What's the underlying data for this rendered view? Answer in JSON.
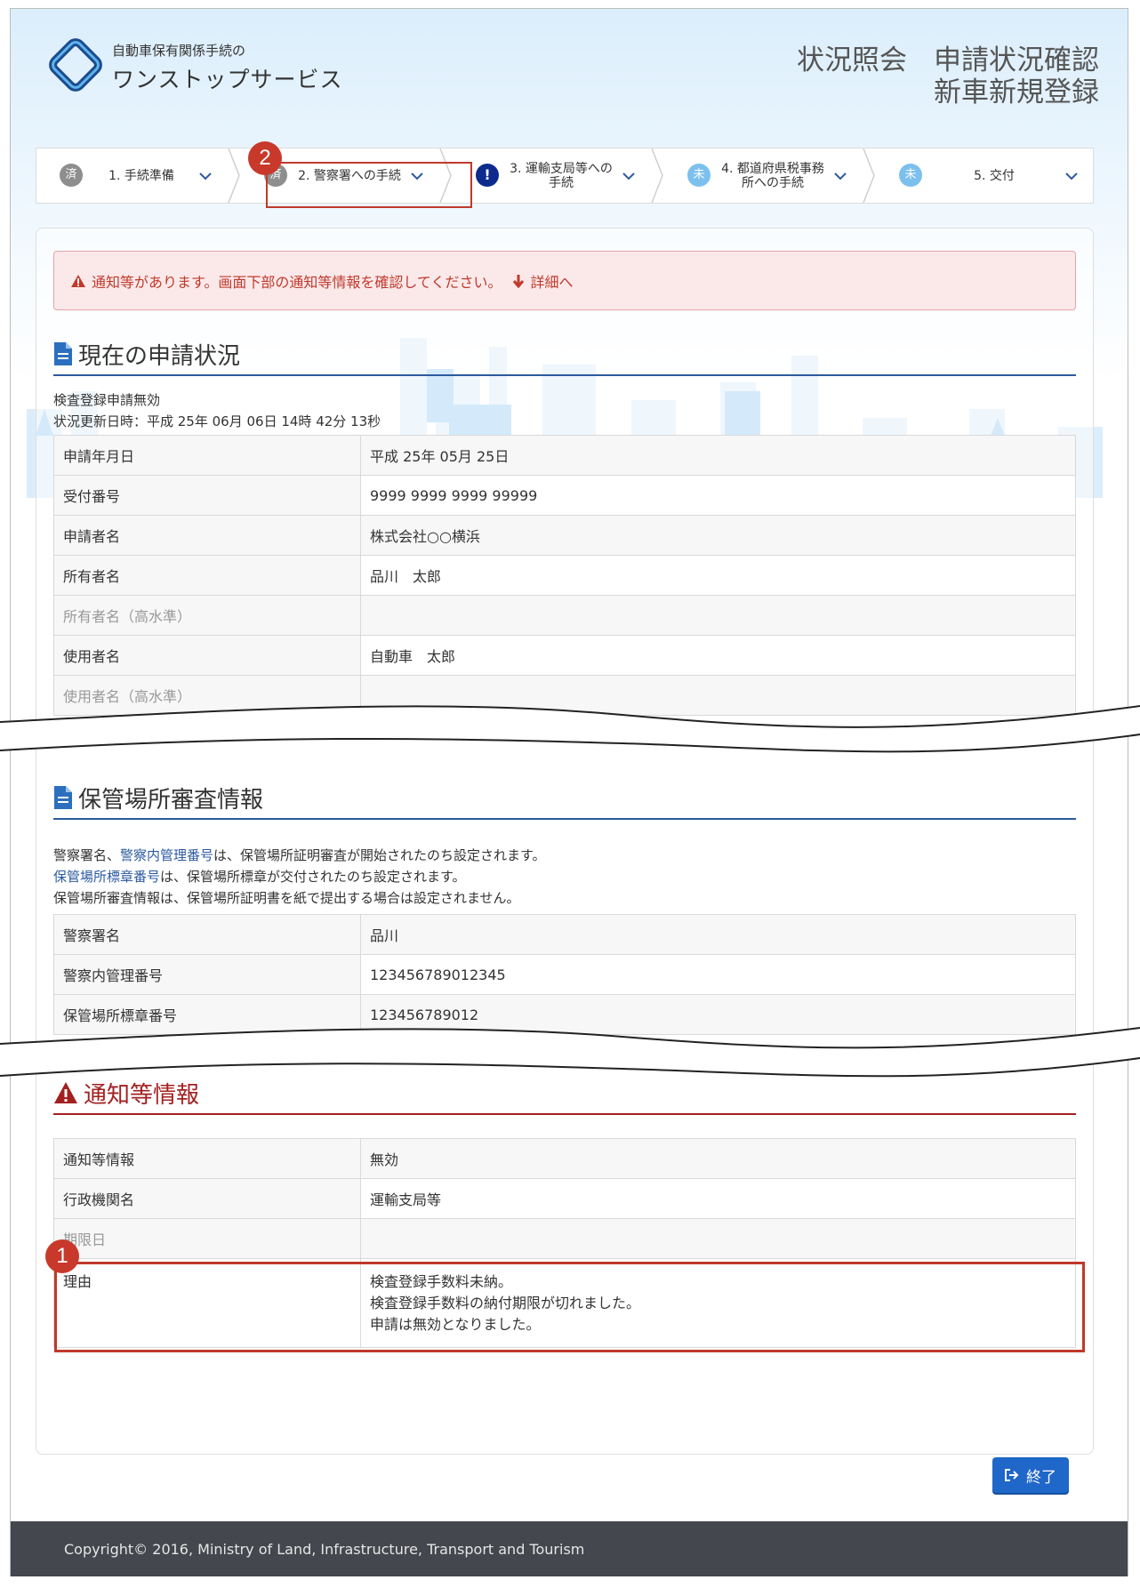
{
  "header": {
    "logo_small": "自動車保有関係手続の",
    "logo_big": "ワンストップサービス",
    "title_line1a": "状況照会",
    "title_line1b": "申請状況確認",
    "title_line2": "新車新規登録"
  },
  "steps": [
    {
      "badge": "済",
      "label": "1. 手続準備",
      "state": "done"
    },
    {
      "badge": "済",
      "label": "2. 警察署への手続",
      "state": "done"
    },
    {
      "badge": "!",
      "label": "3. 運輸支局等への手続",
      "state": "warn"
    },
    {
      "badge": "未",
      "label": "4. 都道府県税事務所への手続",
      "state": "todo"
    },
    {
      "badge": "未",
      "label": "5. 交付",
      "state": "todo"
    }
  ],
  "markers": {
    "m1": "1",
    "m2": "2"
  },
  "alert": {
    "text": "通知等があります。画面下部の通知等情報を確認してください。",
    "link": "詳細へ"
  },
  "status": {
    "heading": "現在の申請状況",
    "line1": "検査登録申請無効",
    "line2": "状況更新日時：平成 25年 06月 06日 14時 42分 13秒",
    "rows": [
      {
        "k": "申請年月日",
        "v": "平成 25年 05月 25日"
      },
      {
        "k": "受付番号",
        "v": "9999 9999 9999 99999"
      },
      {
        "k": "申請者名",
        "v": "株式会社○○横浜"
      },
      {
        "k": "所有者名",
        "v": "品川　太郎"
      },
      {
        "k": "所有者名（高水準）",
        "v": ""
      },
      {
        "k": "使用者名",
        "v": "自動車　太郎"
      },
      {
        "k": "使用者名（高水準）",
        "v": ""
      }
    ]
  },
  "storage": {
    "heading": "保管場所審査情報",
    "note1_a": "警察署名、",
    "note1_b": "警察内管理番号",
    "note1_c": "は、保管場所証明審査が開始されたのち設定されます。",
    "note2_a": "保管場所標章番号",
    "note2_b": "は、保管場所標章が交付されたのち設定されます。",
    "note3": "保管場所審査情報は、保管場所証明書を紙で提出する場合は設定されません。",
    "rows": [
      {
        "k": "警察署名",
        "v": "品川"
      },
      {
        "k": "警察内管理番号",
        "v": "123456789012345"
      },
      {
        "k": "保管場所標章番号",
        "v": "123456789012"
      }
    ]
  },
  "notice": {
    "heading": "通知等情報",
    "rows": [
      {
        "k": "通知等情報",
        "v": "無効"
      },
      {
        "k": "行政機関名",
        "v": "運輸支局等"
      },
      {
        "k": "期限日",
        "v": ""
      }
    ],
    "reason_label": "理由",
    "reason_lines": [
      "検査登録手数料未納。",
      "検査登録手数料の納付期限が切れました。",
      "申請は無効となりました。"
    ]
  },
  "end_button": "終了",
  "footer": "Copyright© 2016, Ministry of Land, Infrastructure, Transport and Tourism",
  "colors": {
    "accent": "#1f67c8",
    "alert": "#c0392b",
    "heading_rule": "#2c5aa0",
    "footer": "#44474d"
  }
}
